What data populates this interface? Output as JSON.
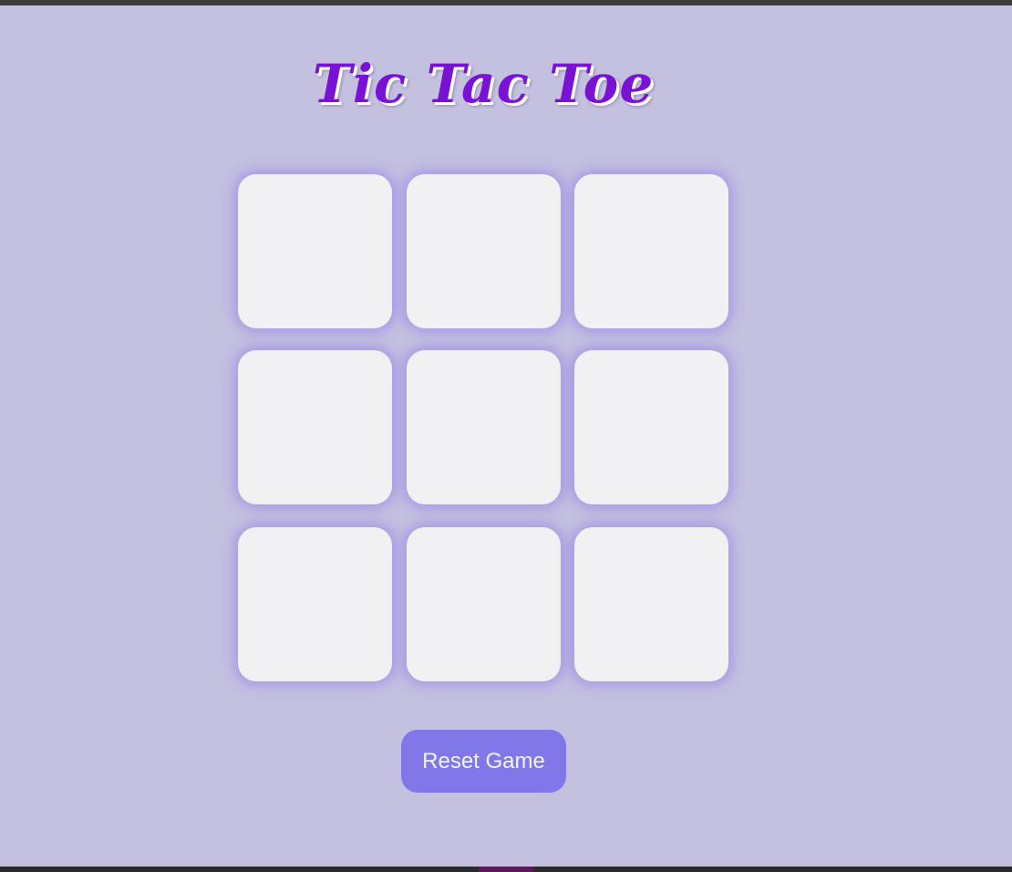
{
  "title": "Tic Tac Toe",
  "board": {
    "cells": [
      "",
      "",
      "",
      "",
      "",
      "",
      "",
      "",
      ""
    ]
  },
  "reset_button": {
    "label": "Reset Game"
  },
  "colors": {
    "background": "#c4c0e0",
    "title": "#7a12d6",
    "cell": "#f1f1f3",
    "cell_glow": "#7b68ee",
    "button": "#8078e8",
    "button_text": "#f4f2ff"
  }
}
